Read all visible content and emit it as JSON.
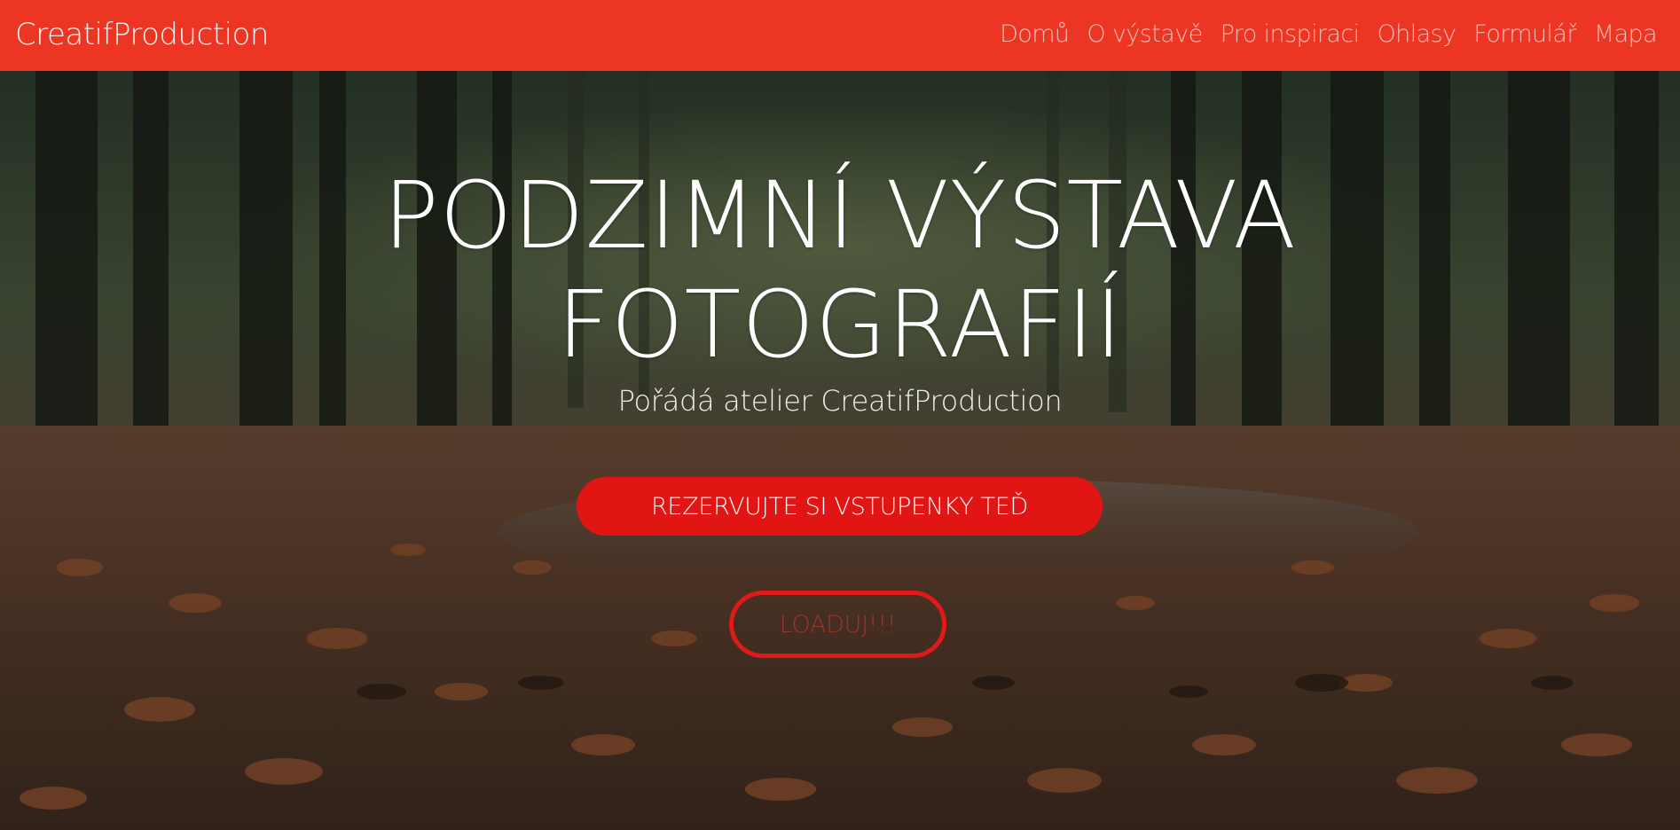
{
  "navbar": {
    "brand": "CreatifProduction",
    "items": [
      {
        "label": "Domů"
      },
      {
        "label": "O výstavě"
      },
      {
        "label": "Pro inspiraci"
      },
      {
        "label": "Ohlasy"
      },
      {
        "label": "Formulář"
      },
      {
        "label": "Mapa"
      }
    ],
    "background_color": "#ec3522"
  },
  "hero": {
    "title_line1": "PODZIMNÍ VÝSTAVA",
    "title_line2": "FOTOGRAFIÍ",
    "subtitle": "Pořádá atelier CreatifProduction",
    "primary_button": "REZERVUJTE SI VSTUPENKY TEĎ",
    "secondary_button": "LOADUJ!!!",
    "button_color": "#e11514"
  }
}
